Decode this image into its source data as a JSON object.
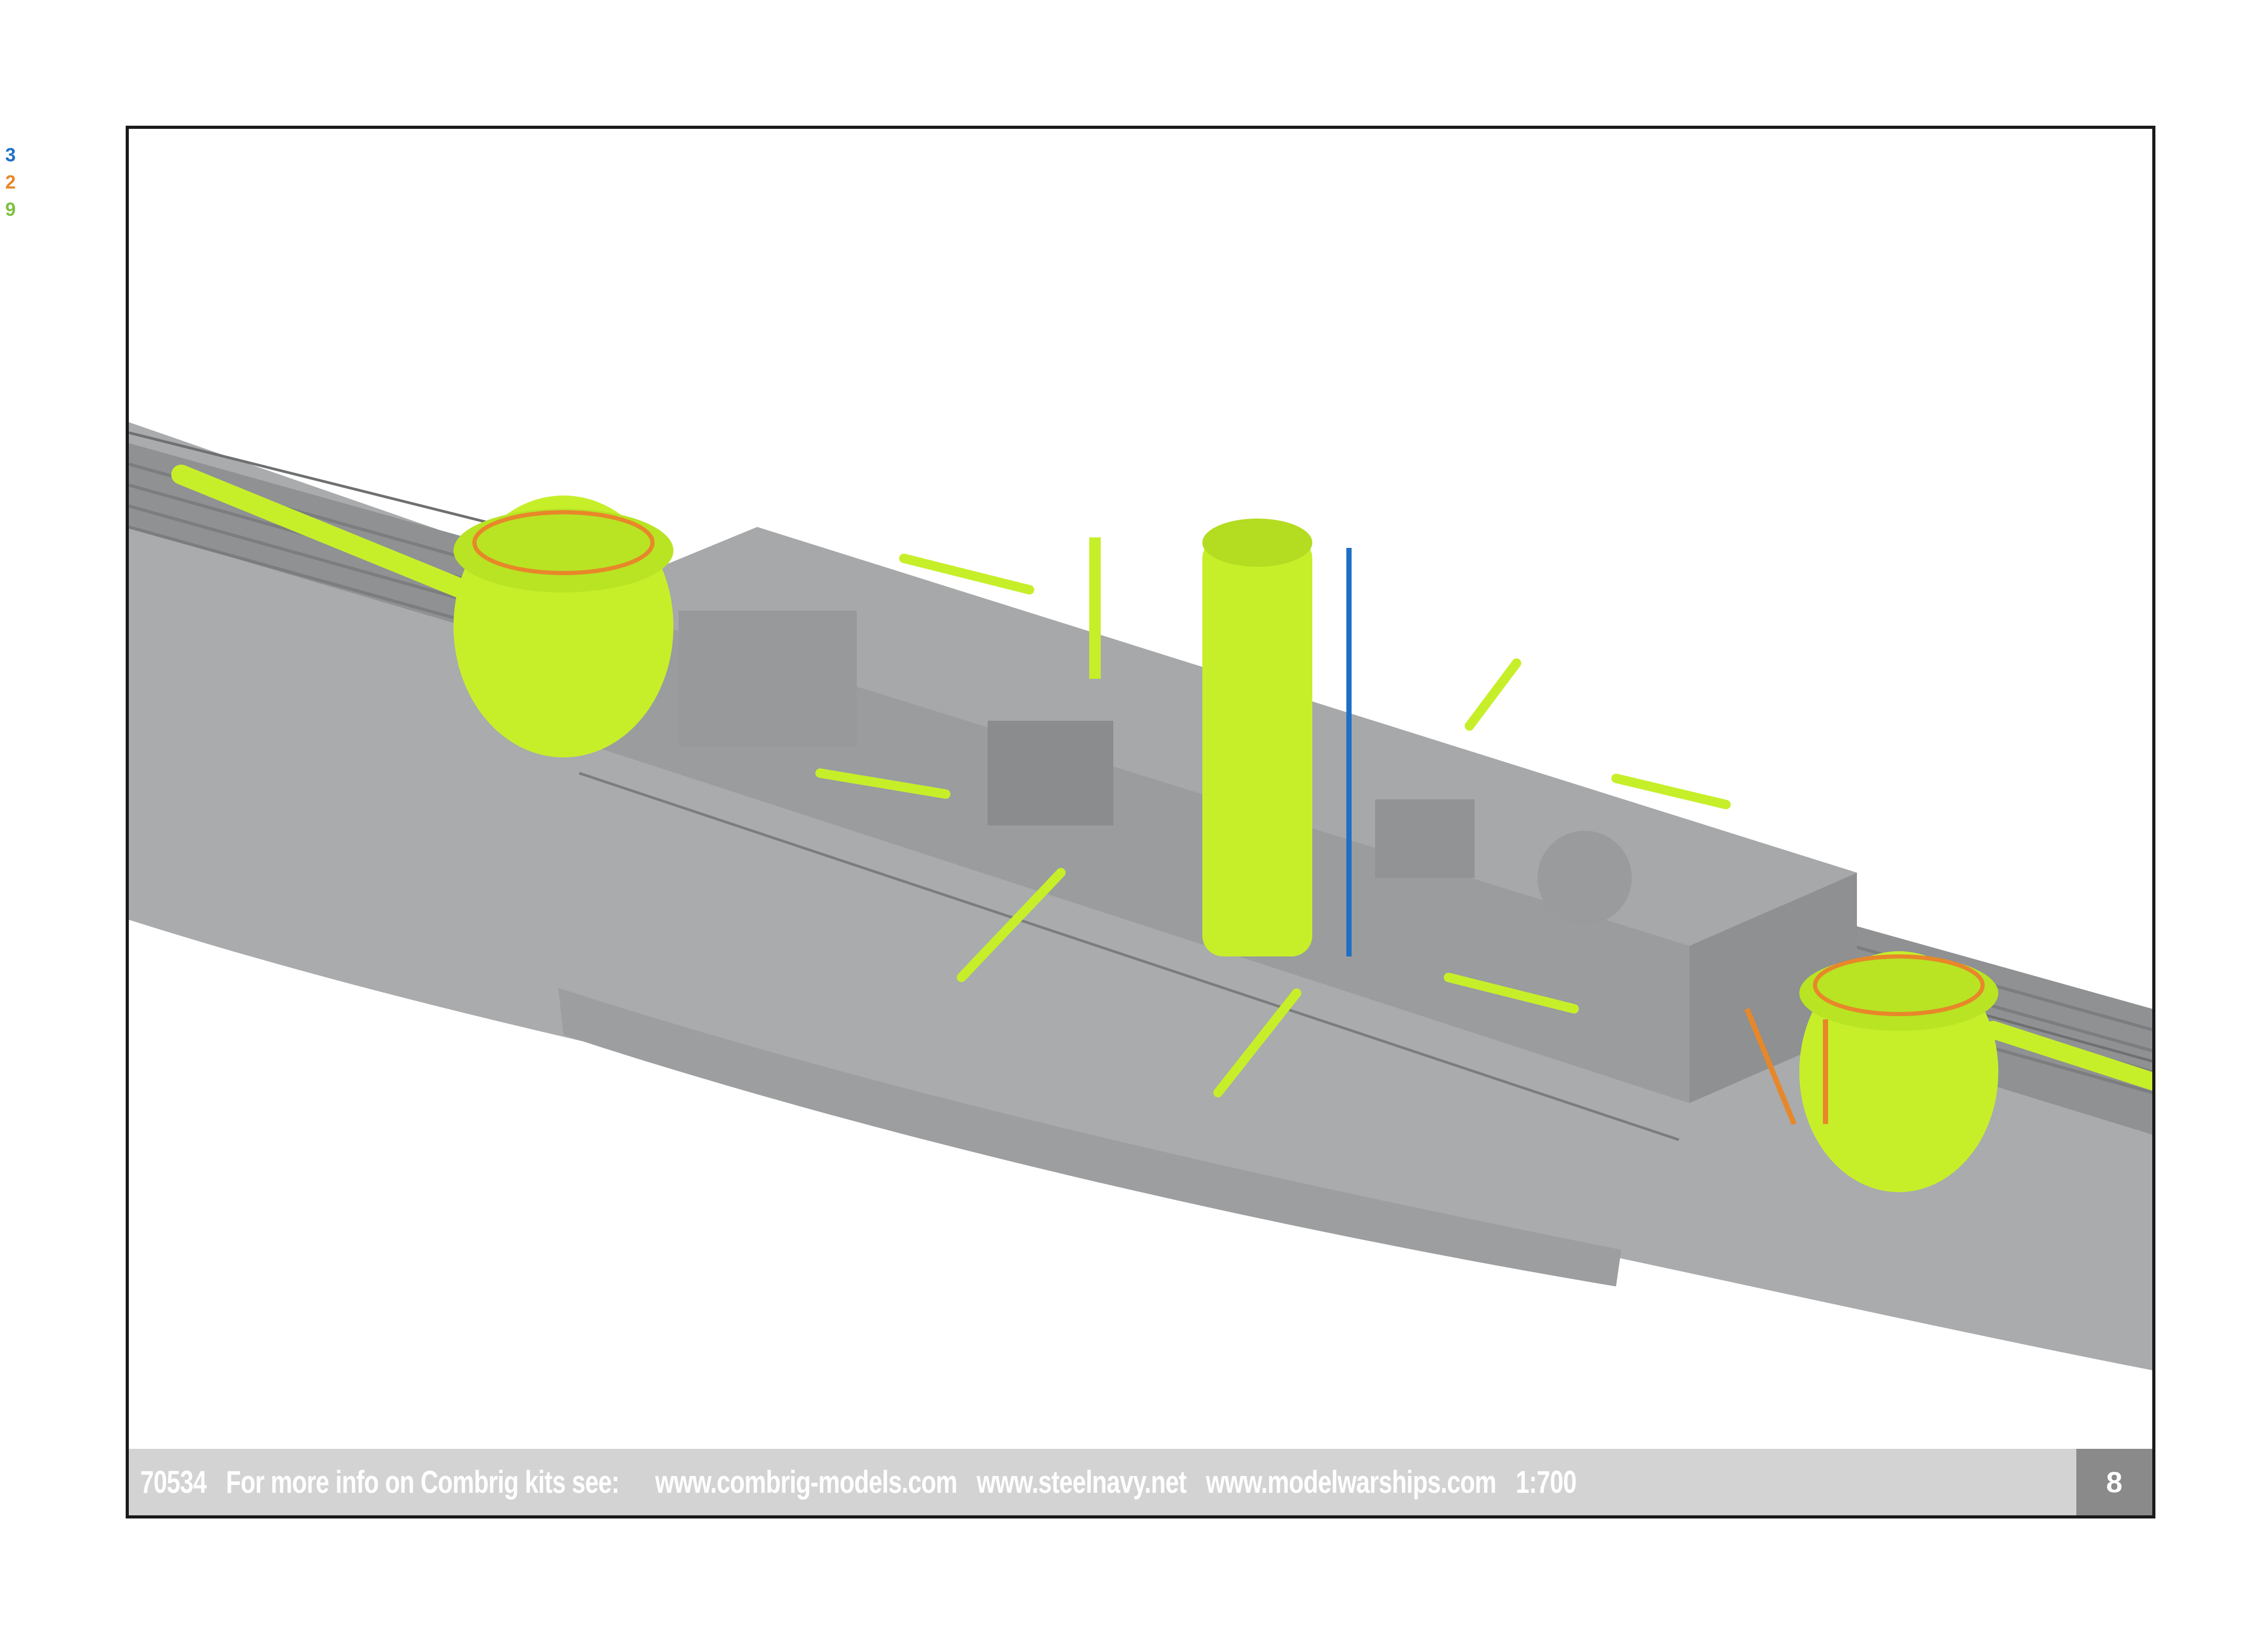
{
  "legend": [
    {
      "text": "3",
      "color": "#1f6fc5"
    },
    {
      "text": "2",
      "color": "#e8872a"
    },
    {
      "text": "9",
      "color": "#7dc242"
    }
  ],
  "footer": {
    "kit_number": "70534",
    "info_text": "For more info on Combrig kits see:",
    "link1": "www.combrig-models.com",
    "link2": "www.steelnavy.net",
    "link3": "www.modelwarships.com",
    "scale": "1:700"
  },
  "page_number": "8",
  "colors": {
    "hull": "#a7a9ab",
    "deck": "#8c8e90",
    "highlight_green": "#c6ef2a",
    "highlight_orange": "#e8872a",
    "highlight_blue": "#1f6fc5",
    "footer_bg": "#d3d3d3",
    "page_badge": "#8a8a8a"
  }
}
